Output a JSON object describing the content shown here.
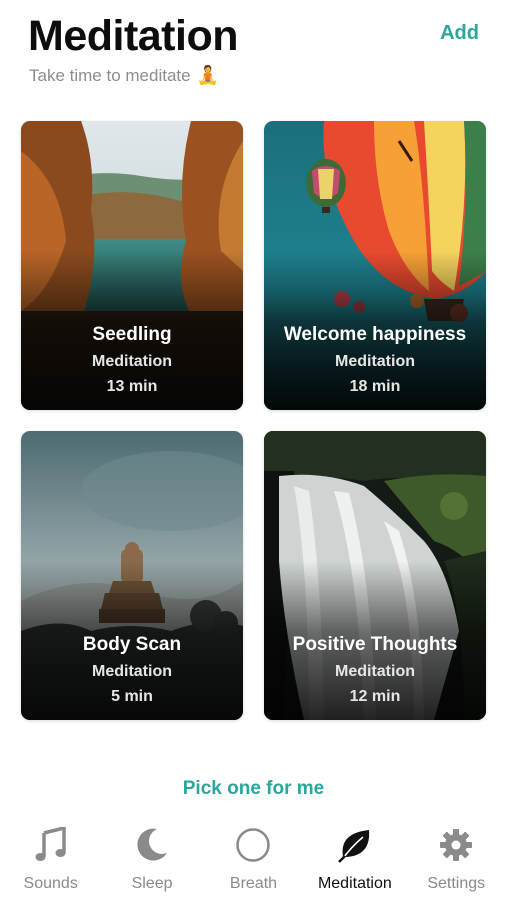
{
  "header": {
    "title": "Meditation",
    "subtitle": "Take time to meditate",
    "subtitle_emoji": "🧘",
    "add_label": "Add"
  },
  "cards": [
    {
      "name": "Seedling",
      "type": "Meditation",
      "duration": "13 min"
    },
    {
      "name": "Welcome happiness",
      "type": "Meditation",
      "duration": "18 min"
    },
    {
      "name": "Body Scan",
      "type": "Meditation",
      "duration": "5 min"
    },
    {
      "name": "Positive Thoughts",
      "type": "Meditation",
      "duration": "12 min"
    }
  ],
  "pick_label": "Pick one for me",
  "tabs": [
    {
      "label": "Sounds",
      "icon": "music-note-icon"
    },
    {
      "label": "Sleep",
      "icon": "moon-icon"
    },
    {
      "label": "Breath",
      "icon": "circle-icon"
    },
    {
      "label": "Meditation",
      "icon": "leaf-icon",
      "active": true
    },
    {
      "label": "Settings",
      "icon": "gear-icon"
    }
  ],
  "colors": {
    "accent": "#2ca69a",
    "title": "#0d0d0d",
    "tab_inactive": "#8a8a8a",
    "tab_active": "#111111"
  }
}
